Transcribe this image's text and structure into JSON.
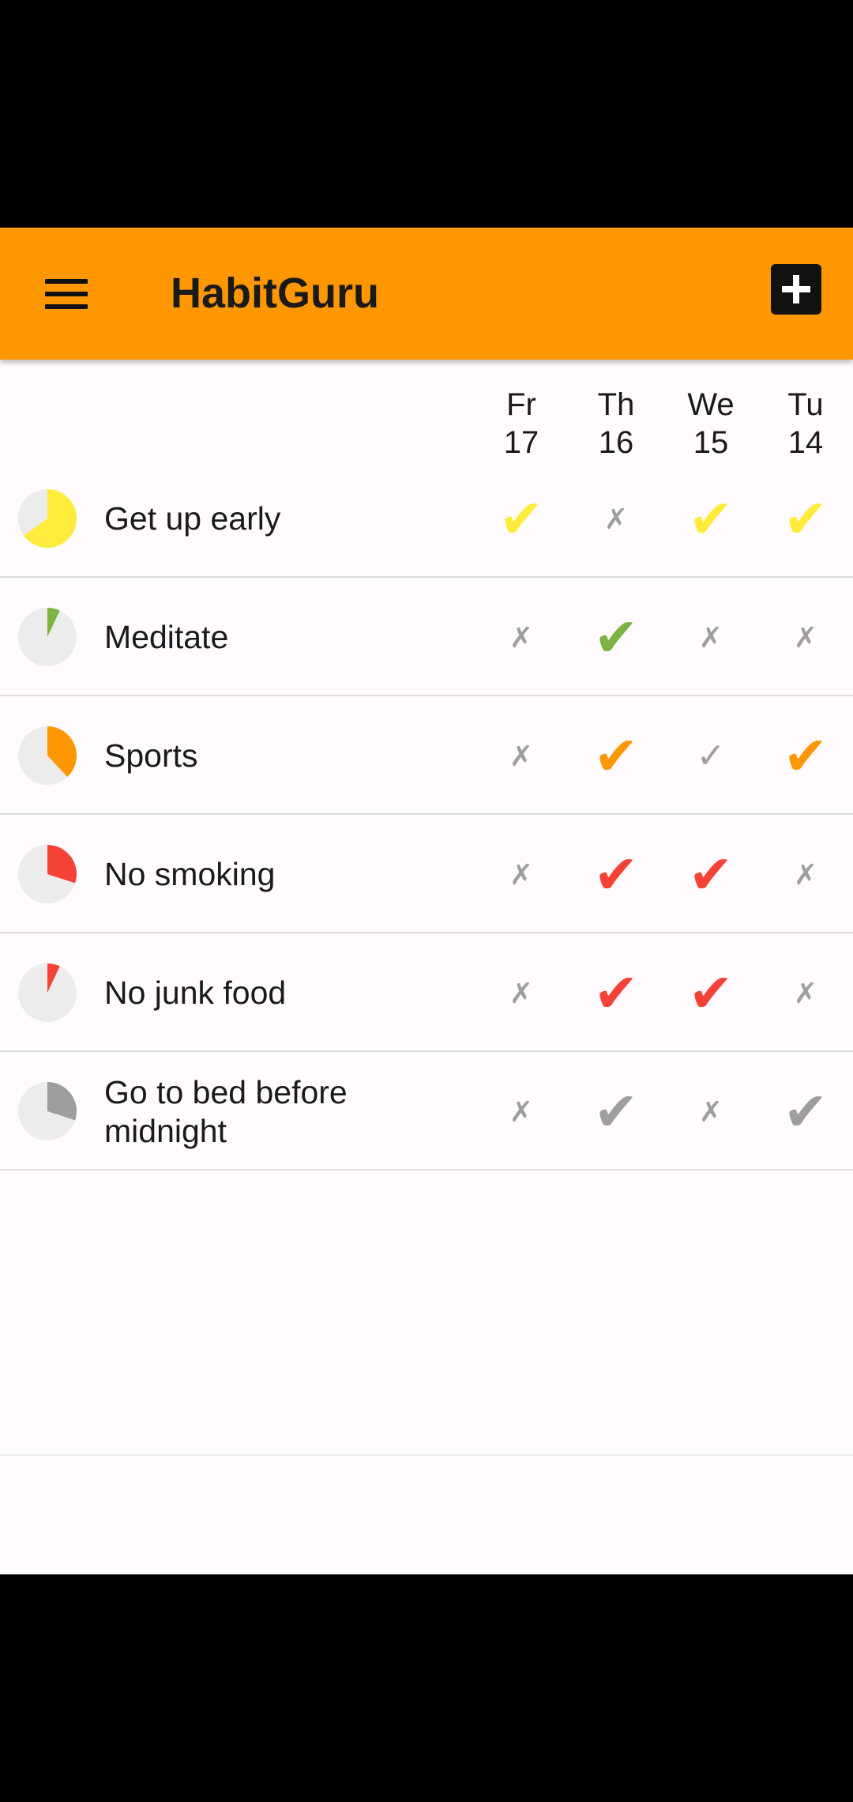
{
  "app_bar": {
    "title": "HabitGuru",
    "menu_icon": "hamburger-menu-icon",
    "add_icon": "add-box-icon",
    "color": "#ff9800"
  },
  "days": [
    {
      "weekday": "Fr",
      "date": "17"
    },
    {
      "weekday": "Th",
      "date": "16"
    },
    {
      "weekday": "We",
      "date": "15"
    },
    {
      "weekday": "Tu",
      "date": "14"
    }
  ],
  "habits": [
    {
      "name": "Get up early",
      "color": "#ffeb3b",
      "progress": 0.65,
      "days": [
        "check",
        "cross",
        "check",
        "check"
      ]
    },
    {
      "name": "Meditate",
      "color": "#7cb342",
      "progress": 0.07,
      "days": [
        "cross",
        "check",
        "cross",
        "cross"
      ]
    },
    {
      "name": "Sports",
      "color": "#ff9800",
      "progress": 0.38,
      "days": [
        "cross",
        "check",
        "skip",
        "check"
      ]
    },
    {
      "name": "No smoking",
      "color": "#f44336",
      "progress": 0.3,
      "days": [
        "cross",
        "check",
        "check",
        "cross"
      ]
    },
    {
      "name": "No junk food",
      "color": "#f44336",
      "progress": 0.07,
      "days": [
        "cross",
        "check",
        "check",
        "cross"
      ]
    },
    {
      "name": "Go to bed before midnight",
      "color": "#9e9e9e",
      "progress": 0.3,
      "days": [
        "cross",
        "check",
        "cross",
        "check"
      ]
    }
  ],
  "symbols": {
    "check": "✔",
    "cross": "✗",
    "skip": "✓"
  }
}
